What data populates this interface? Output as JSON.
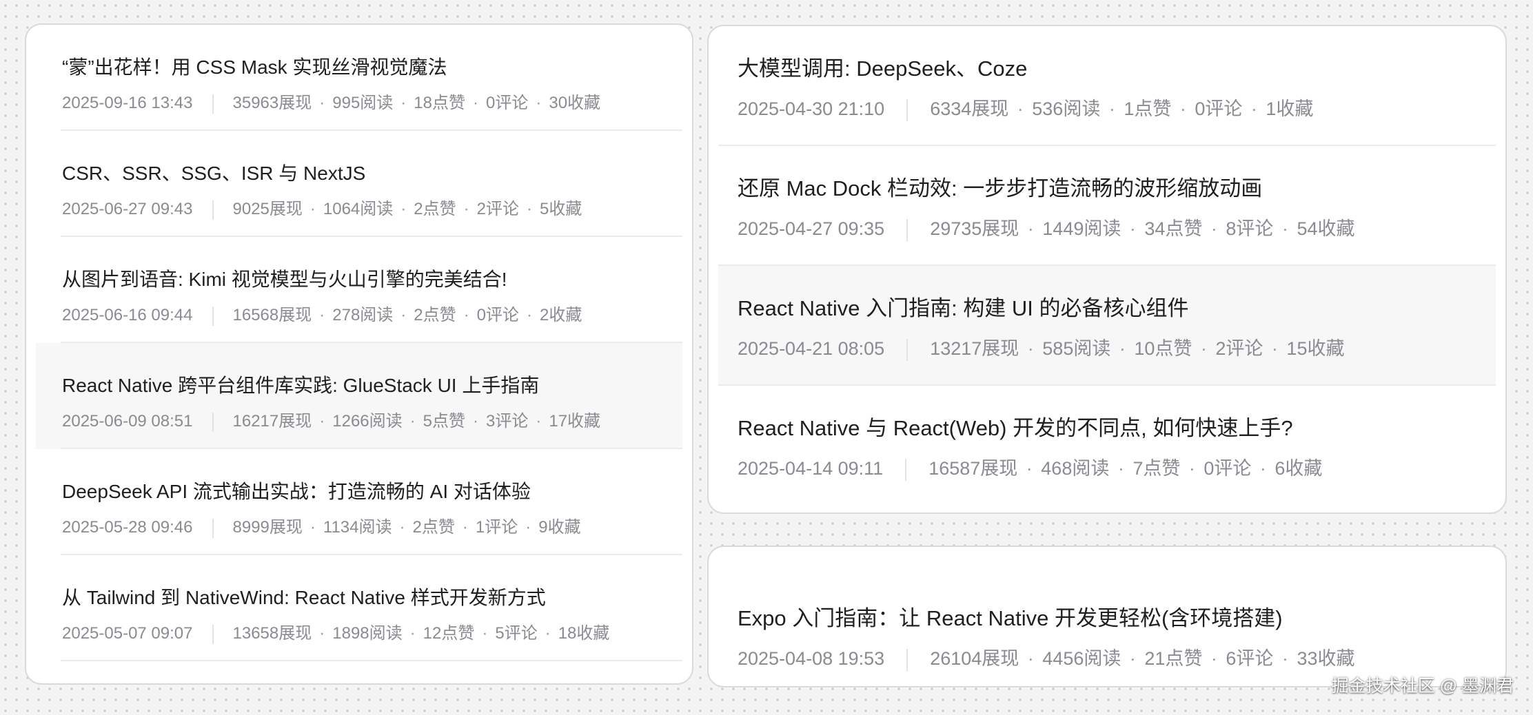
{
  "left_articles": [
    {
      "title": "“蒙”出花样！用 CSS Mask 实现丝滑视觉魔法",
      "date": "2025-09-16 13:43",
      "views": "35963展现",
      "reads": "995阅读",
      "likes": "18点赞",
      "comments": "0评论",
      "favorites": "30收藏",
      "highlighted": false
    },
    {
      "title": "CSR、SSR、SSG、ISR 与 NextJS",
      "date": "2025-06-27 09:43",
      "views": "9025展现",
      "reads": "1064阅读",
      "likes": "2点赞",
      "comments": "2评论",
      "favorites": "5收藏",
      "highlighted": false
    },
    {
      "title": "从图片到语音: Kimi 视觉模型与火山引擎的完美结合!",
      "date": "2025-06-16 09:44",
      "views": "16568展现",
      "reads": "278阅读",
      "likes": "2点赞",
      "comments": "0评论",
      "favorites": "2收藏",
      "highlighted": false
    },
    {
      "title": "React Native 跨平台组件库实践: GlueStack UI 上手指南",
      "date": "2025-06-09 08:51",
      "views": "16217展现",
      "reads": "1266阅读",
      "likes": "5点赞",
      "comments": "3评论",
      "favorites": "17收藏",
      "highlighted": true
    },
    {
      "title": "DeepSeek API 流式输出实战：打造流畅的 AI 对话体验",
      "date": "2025-05-28 09:46",
      "views": "8999展现",
      "reads": "1134阅读",
      "likes": "2点赞",
      "comments": "1评论",
      "favorites": "9收藏",
      "highlighted": false
    },
    {
      "title": "从 Tailwind 到 NativeWind: React Native 样式开发新方式",
      "date": "2025-05-07 09:07",
      "views": "13658展现",
      "reads": "1898阅读",
      "likes": "12点赞",
      "comments": "5评论",
      "favorites": "18收藏",
      "highlighted": false
    }
  ],
  "right_articles": [
    {
      "title": "大模型调用: DeepSeek、Coze",
      "date": "2025-04-30 21:10",
      "views": "6334展现",
      "reads": "536阅读",
      "likes": "1点赞",
      "comments": "0评论",
      "favorites": "1收藏",
      "highlighted": false
    },
    {
      "title": "还原 Mac Dock 栏动效: 一步步打造流畅的波形缩放动画",
      "date": "2025-04-27 09:35",
      "views": "29735展现",
      "reads": "1449阅读",
      "likes": "34点赞",
      "comments": "8评论",
      "favorites": "54收藏",
      "highlighted": false
    },
    {
      "title": "React Native 入门指南: 构建 UI 的必备核心组件",
      "date": "2025-04-21 08:05",
      "views": "13217展现",
      "reads": "585阅读",
      "likes": "10点赞",
      "comments": "2评论",
      "favorites": "15收藏",
      "highlighted": true
    },
    {
      "title": "React Native 与 React(Web) 开发的不同点, 如何快速上手?",
      "date": "2025-04-14 09:11",
      "views": "16587展现",
      "reads": "468阅读",
      "likes": "7点赞",
      "comments": "0评论",
      "favorites": "6收藏",
      "highlighted": false
    }
  ],
  "bottom_articles": [
    {
      "title": "Expo 入门指南：让 React Native 开发更轻松(含环境搭建)",
      "date": "2025-04-08 19:53",
      "views": "26104展现",
      "reads": "4456阅读",
      "likes": "21点赞",
      "comments": "6评论",
      "favorites": "33收藏",
      "highlighted": false
    }
  ],
  "separator_dot": "·",
  "watermark": "掘金技术社区 @ 墨渊君",
  "colors": {
    "background": "#f4f4f5",
    "card": "#ffffff",
    "title": "#1f1f22",
    "meta": "#8a8b90",
    "hover": "#f7f7f8"
  }
}
